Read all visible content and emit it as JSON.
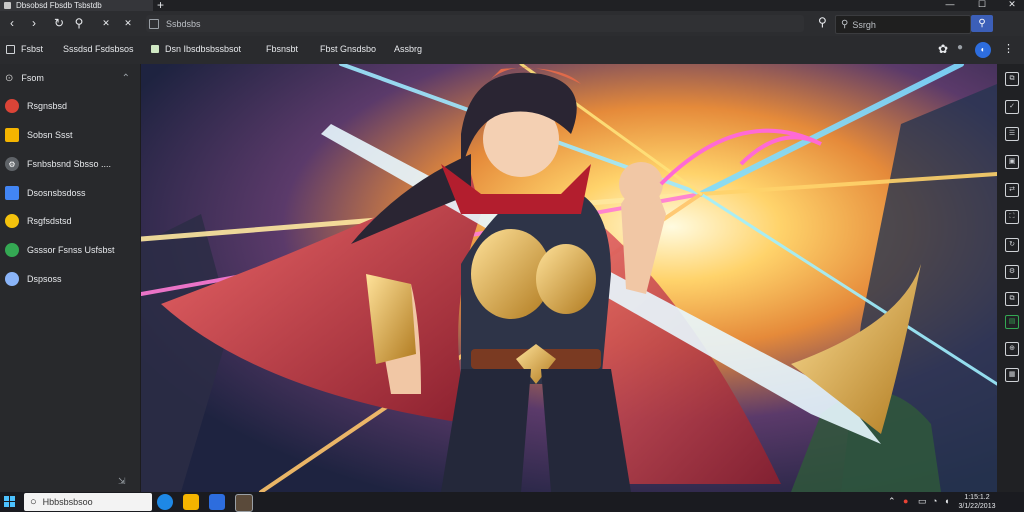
{
  "window": {
    "tab_title": "Dbsobsd Fbsdb Tsbstdb",
    "new_tab": "+",
    "minimize": "—",
    "maximize": "☐",
    "close": "✕"
  },
  "toolbar": {
    "back": "‹",
    "forward": "›",
    "reload": "↻",
    "extensions": "⚲",
    "tab_close": "✕",
    "address_value": "Ssbdsbs",
    "search_placeholder": "Ssrgh",
    "search_go": "⚲"
  },
  "bookmarks": [
    {
      "label": "Fsbst",
      "color": "#9aa0a6"
    },
    {
      "label": "Sssdsd Fsdsbsos",
      "color": ""
    },
    {
      "label": "Dsn Ibsdbsbssbsot",
      "color": "#7fbf6a"
    },
    {
      "label": "Fbsnsbt",
      "color": ""
    },
    {
      "label": "Fbst Gnsdsbo",
      "color": ""
    },
    {
      "label": "Assbrg",
      "color": ""
    }
  ],
  "sidebar": {
    "header": "Fsom",
    "items": [
      {
        "label": "Rsgnsbsd",
        "icon": "chrome-icon",
        "color": "#db4437"
      },
      {
        "label": "Sobsn Ssst",
        "icon": "folder-icon",
        "color": "#f4b400"
      },
      {
        "label": "Fsnbsbsnd Sbsso ....",
        "icon": "gear-icon",
        "color": "#5f6368"
      },
      {
        "label": "Dsosnsbsdoss",
        "icon": "screen-icon",
        "color": "#4285f4"
      },
      {
        "label": "Rsgfsdstsd",
        "icon": "star-icon",
        "color": "#f4c20d"
      },
      {
        "label": "Gsssor Fsnss Usfsbst",
        "icon": "leaf-icon",
        "color": "#34a853"
      },
      {
        "label": "Dspsoss",
        "icon": "disc-icon",
        "color": "#8ab4f8"
      }
    ],
    "footer": "⇲"
  },
  "rail": [
    "⧉",
    "✓",
    "☰",
    "▣",
    "⇄",
    "⛶",
    "↻",
    "⚙",
    "⧉",
    "▤",
    "⊕",
    "▦"
  ],
  "taskbar": {
    "search_placeholder": "Hbbsbsbsoo",
    "clock_time": "1:15:1.2",
    "clock_date": "3/1/22/2013"
  },
  "colors": {
    "accent": "#3c5fb8",
    "taskbar": "#1a1b20",
    "sidebar": "#28292c"
  }
}
